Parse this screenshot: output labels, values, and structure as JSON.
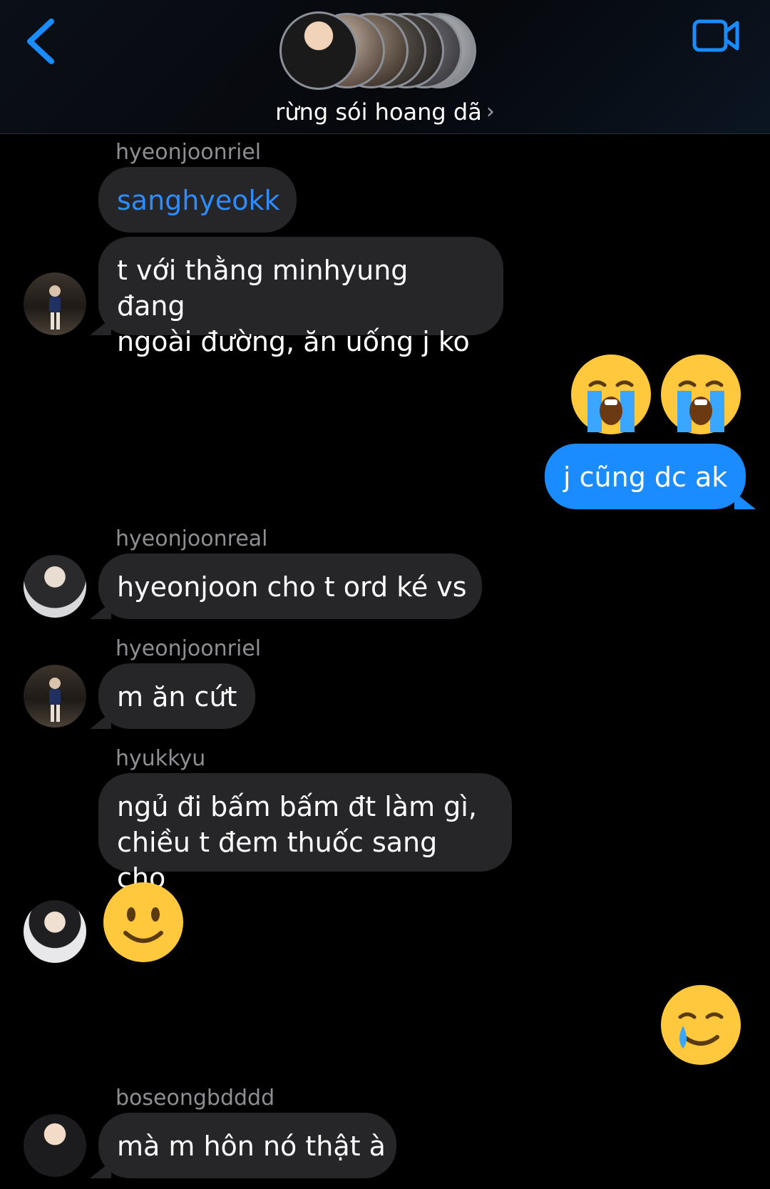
{
  "header": {
    "title": "rừng sói hoang dã",
    "back_icon": "chevron-left-icon",
    "video_icon": "video-camera-icon",
    "accent": "#1a8cff"
  },
  "messages": [
    {
      "sender": "hyeonjoonriel",
      "text": "sanghyeokk",
      "type": "mention"
    },
    {
      "text_line1": "t với thằng minhyung đang",
      "text_line2": "ngoài đường, ăn uống j ko"
    },
    {
      "emoji": "loudly-crying-face-icon",
      "count": 2,
      "direction": "outgoing"
    },
    {
      "text": "j cũng dc ak",
      "direction": "outgoing"
    },
    {
      "sender": "hyeonjoonreal",
      "text": "hyeonjoon cho t ord ké vs"
    },
    {
      "sender": "hyeonjoonriel",
      "text": "m ăn cứt"
    },
    {
      "sender": "hyukkyu",
      "text_line1": "ngủ đi bấm bấm đt làm gì,",
      "text_line2": "chiều t đem thuốc sang cho"
    },
    {
      "emoji": "slightly-smiling-face-icon",
      "direction": "incoming"
    },
    {
      "emoji": "smiling-face-with-tear-icon",
      "direction": "outgoing"
    },
    {
      "sender": "boseongbdddd",
      "text": "mà m hôn nó thật à"
    }
  ],
  "colors": {
    "incoming_bubble": "#262628",
    "outgoing_bubble": "#1a8cff",
    "mention_text": "#2d8cff",
    "sender_name": "#8e8e93"
  }
}
